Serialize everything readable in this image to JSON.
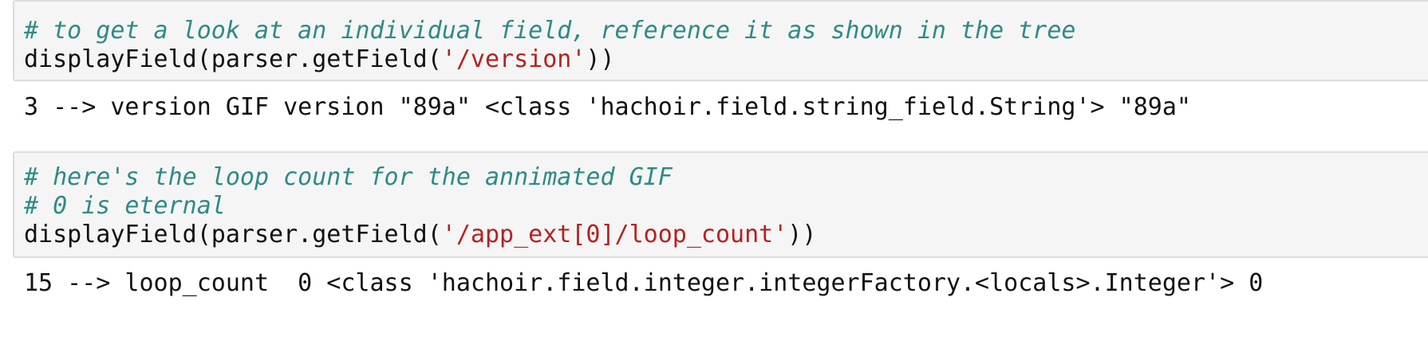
{
  "cells": [
    {
      "input": {
        "comment_1": "# to get a look at an individual field, reference it as shown in the tree",
        "code_prefix": "displayField(parser.getField(",
        "code_string": "'/version'",
        "code_suffix": "))"
      },
      "output": "3 --> version GIF version \"89a\" <class 'hachoir.field.string_field.String'> \"89a\""
    },
    {
      "input": {
        "comment_1": "# here's the loop count for the annimated GIF",
        "comment_2": "# 0 is eternal",
        "code_prefix": "displayField(parser.getField(",
        "code_string": "'/app_ext[0]/loop_count'",
        "code_suffix": "))"
      },
      "output": "15 --> loop_count  0 <class 'hachoir.field.integer.integerFactory.<locals>.Integer'> 0"
    }
  ],
  "colors": {
    "comment": "#2f8a86",
    "string": "#b32222",
    "code": "#111111",
    "cell_background": "#f5f5f5",
    "cell_border": "#dddddd"
  }
}
